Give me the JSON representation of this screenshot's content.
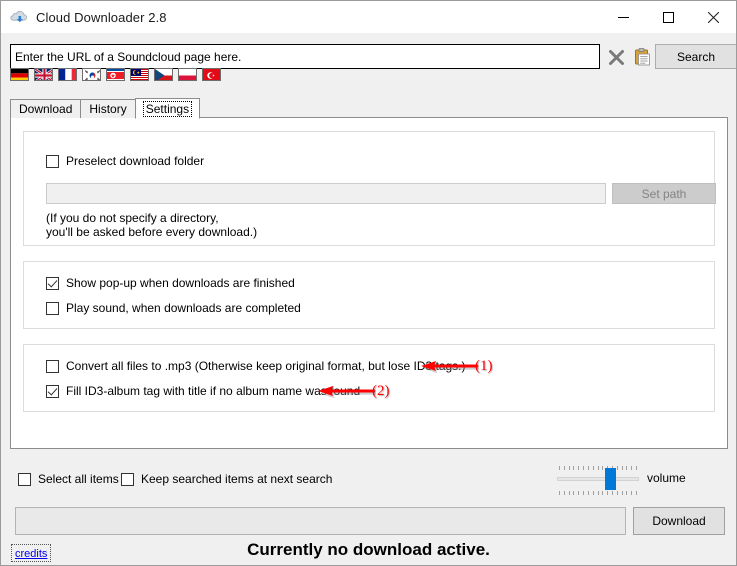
{
  "window": {
    "title": "Cloud Downloader 2.8",
    "icon": "cloud-download-icon",
    "minimize_label": "—",
    "maximize_label": "□",
    "close_label": "✕"
  },
  "toolbar": {
    "url_value": "Enter the URL of a Soundcloud page here.",
    "url_placeholder": "Enter the URL of a Soundcloud page here.",
    "clear_icon": "clear-x-icon",
    "paste_icon": "clipboard-paste-icon",
    "search_label": "Search"
  },
  "languages": [
    {
      "name": "German",
      "code": "de"
    },
    {
      "name": "United Kingdom",
      "code": "gb"
    },
    {
      "name": "France",
      "code": "fr"
    },
    {
      "name": "South Korea",
      "code": "kr"
    },
    {
      "name": "North Korea",
      "code": "kp"
    },
    {
      "name": "Malaysia",
      "code": "my"
    },
    {
      "name": "Czech Republic",
      "code": "cz"
    },
    {
      "name": "Poland",
      "code": "pl"
    },
    {
      "name": "Turkey",
      "code": "tr"
    }
  ],
  "tabs": [
    {
      "label": "Download",
      "active": false
    },
    {
      "label": "History",
      "active": false
    },
    {
      "label": "Settings",
      "active": true
    }
  ],
  "settings": {
    "group_folder": {
      "preselect_label": "Preselect download folder",
      "preselect_checked": false,
      "path_value": "",
      "path_placeholder": "",
      "set_path_label": "Set path",
      "set_path_enabled": false,
      "hint_line1": "(If you do not specify a directory,",
      "hint_line2": "you'll be asked before every download.)"
    },
    "group_notify": {
      "popup_label": "Show pop-up when downloads are finished",
      "popup_checked": true,
      "sound_label": "Play sound, when downloads are completed",
      "sound_checked": false
    },
    "group_format": {
      "convert_label": "Convert all files to .mp3 (Otherwise keep original format, but lose ID3 tags.)",
      "convert_checked": false,
      "fill_label": "Fill ID3-album tag with title if no album name was found",
      "fill_checked": true
    }
  },
  "annotations": [
    {
      "id": "1",
      "text": "(1)",
      "color": "#ff0000",
      "target": "convert-all-to-mp3-checkbox"
    },
    {
      "id": "2",
      "text": "(2)",
      "color": "#ff0000",
      "target": "fill-id3-album-tag-checkbox"
    }
  ],
  "bottom": {
    "select_all_label": "Select all items",
    "select_all_checked": false,
    "keep_searched_label": "Keep searched items at next search",
    "keep_searched_checked": false,
    "volume_label": "volume",
    "volume_value": 62,
    "volume_min": 0,
    "volume_max": 100,
    "progress_value": "",
    "download_label": "Download",
    "credits_label": "credits",
    "status_text": "Currently no download active."
  },
  "colors": {
    "accent": "#0078d7",
    "annotation": "#ff0000",
    "link": "#0000ee",
    "window_bg": "#f0f0f0",
    "panel_bg": "#ffffff"
  }
}
